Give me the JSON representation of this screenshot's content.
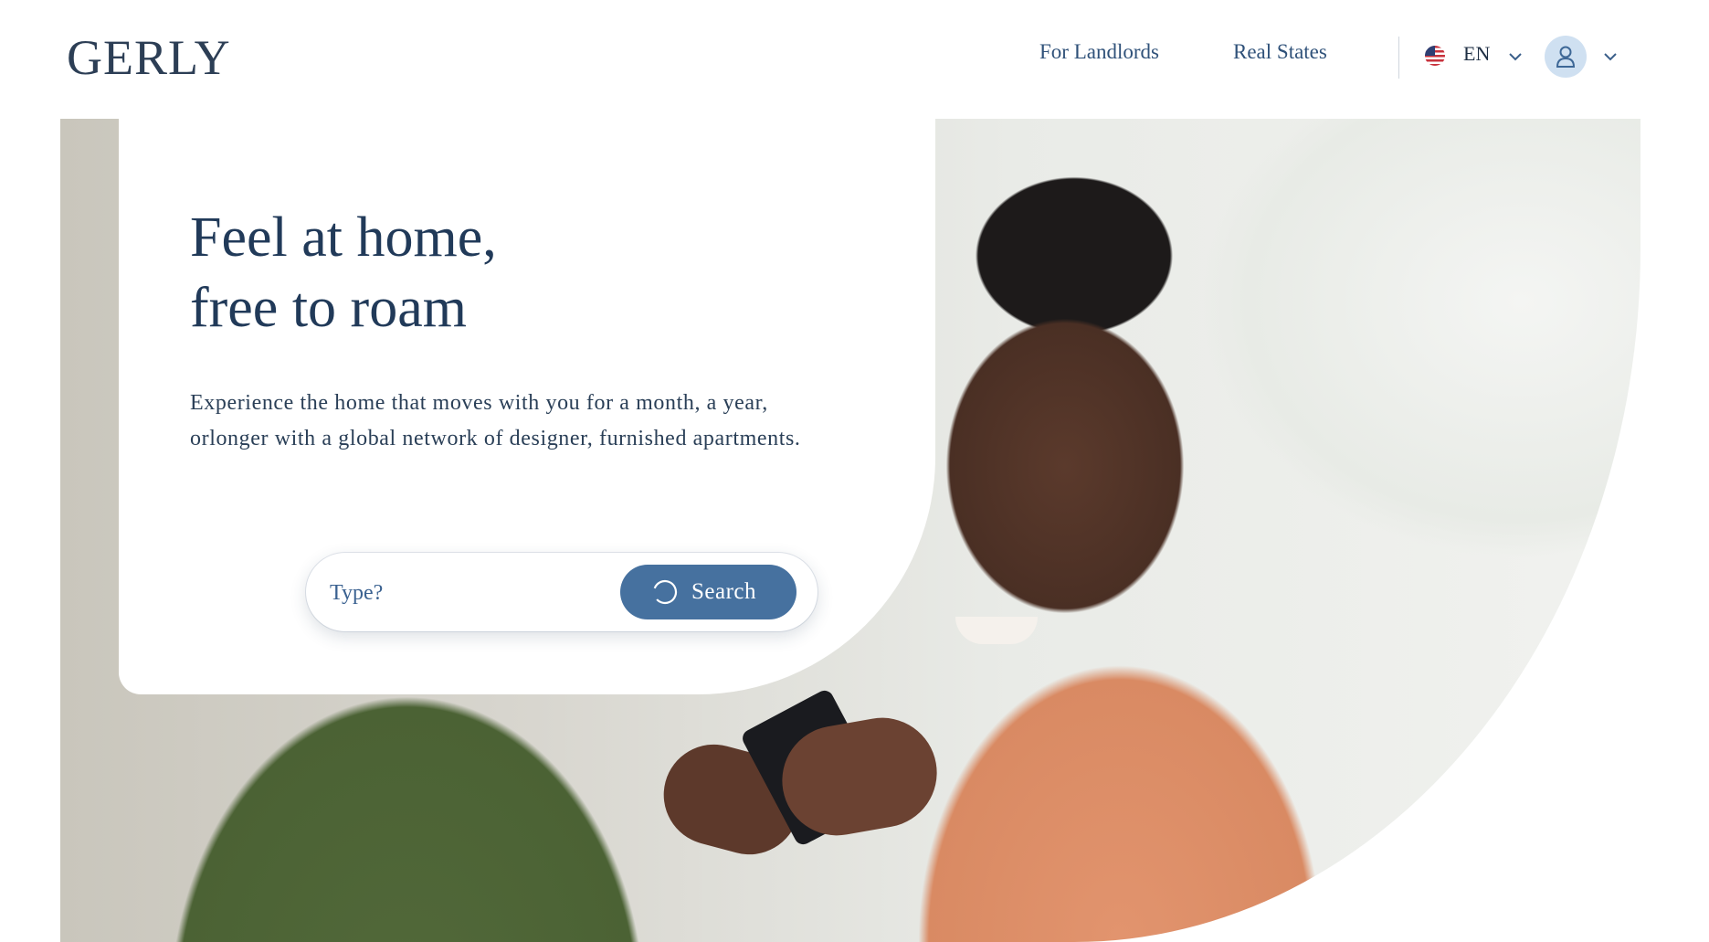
{
  "brand": {
    "logo_text": "GERLY"
  },
  "nav": {
    "links": [
      {
        "label": "For Landlords"
      },
      {
        "label": "Real States"
      }
    ],
    "language": {
      "code": "EN",
      "flag_icon": "us-flag-icon"
    },
    "user_menu_icon": "user-icon"
  },
  "hero": {
    "headline": "Feel at home,\nfree to roam",
    "subtext": "Experience the home that moves with you for a month, a year, orlonger with a global network of designer, furnished apartments.",
    "search": {
      "placeholder": "Type?",
      "button_label": "Search",
      "button_icon": "search-spinner-icon"
    }
  },
  "colors": {
    "primary": "#46719f",
    "heading": "#213a59",
    "nav_text": "#2f5179",
    "avatar_bg": "#cfe0f1"
  }
}
